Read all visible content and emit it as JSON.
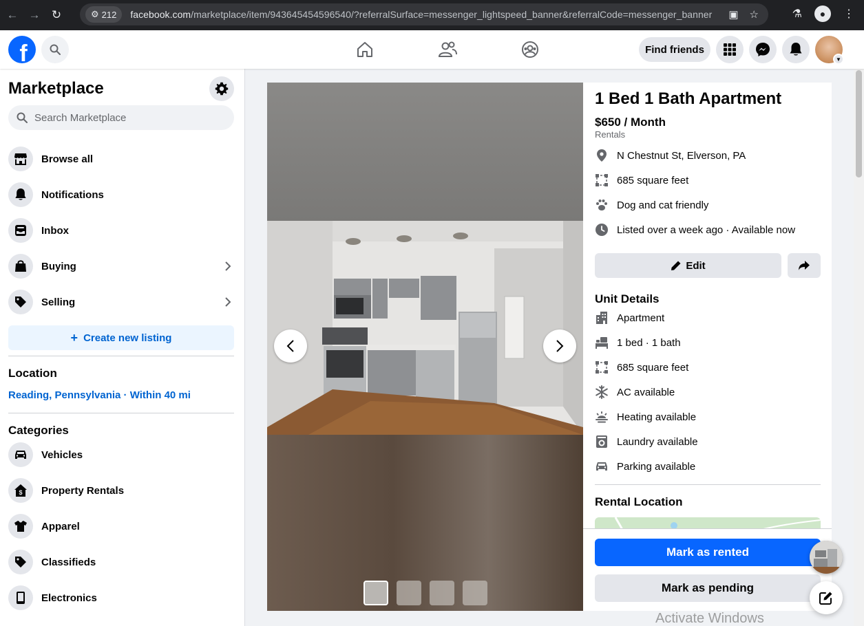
{
  "browser": {
    "badge_count": "212",
    "url_host": "facebook.com",
    "url_path": "/marketplace/item/943645454596540/?referralSurface=messenger_lightspeed_banner&referralCode=messenger_banner"
  },
  "topbar": {
    "find_friends_label": "Find friends"
  },
  "sidebar": {
    "title": "Marketplace",
    "search_placeholder": "Search Marketplace",
    "nav": [
      {
        "label": "Browse all",
        "icon": "storefront-icon"
      },
      {
        "label": "Notifications",
        "icon": "bell-icon"
      },
      {
        "label": "Inbox",
        "icon": "inbox-icon"
      },
      {
        "label": "Buying",
        "icon": "shopping-bag-icon"
      },
      {
        "label": "Selling",
        "icon": "price-tag-icon"
      }
    ],
    "create_listing_label": "Create new listing",
    "location_heading": "Location",
    "location_value": "Reading, Pennsylvania · Within 40 mi",
    "categories_heading": "Categories",
    "categories": [
      {
        "label": "Vehicles",
        "icon": "car-icon"
      },
      {
        "label": "Property Rentals",
        "icon": "house-dollar-icon"
      },
      {
        "label": "Apparel",
        "icon": "shirt-icon"
      },
      {
        "label": "Classifieds",
        "icon": "price-tag-icon"
      },
      {
        "label": "Electronics",
        "icon": "phone-icon"
      }
    ]
  },
  "listing": {
    "title": "1 Bed 1 Bath Apartment",
    "price": "$650 / Month",
    "category": "Rentals",
    "facts": [
      {
        "text": "N Chestnut St, Elverson, PA",
        "icon": "map-pin-icon"
      },
      {
        "text": "685 square feet",
        "icon": "area-icon"
      },
      {
        "text": "Dog and cat friendly",
        "icon": "paw-icon"
      },
      {
        "text": "Listed over a week ago · Available now",
        "icon": "clock-icon"
      }
    ],
    "edit_label": "Edit",
    "unit_details_heading": "Unit Details",
    "unit_details": [
      {
        "text": "Apartment",
        "icon": "building-icon"
      },
      {
        "text": "1 bed · 1 bath",
        "icon": "bed-icon"
      },
      {
        "text": "685 square feet",
        "icon": "area-icon"
      },
      {
        "text": "AC available",
        "icon": "snowflake-icon"
      },
      {
        "text": "Heating available",
        "icon": "heat-icon"
      },
      {
        "text": "Laundry available",
        "icon": "washer-icon"
      },
      {
        "text": "Parking available",
        "icon": "car-icon"
      }
    ],
    "rental_location_heading": "Rental Location",
    "photo_count": 4,
    "active_photo_index": 1
  },
  "actions": {
    "mark_rented_label": "Mark as rented",
    "mark_pending_label": "Mark as pending"
  },
  "overlay": {
    "watermark": "Activate Windows"
  },
  "colors": {
    "brand": "#0866ff",
    "link": "#0064d1"
  }
}
